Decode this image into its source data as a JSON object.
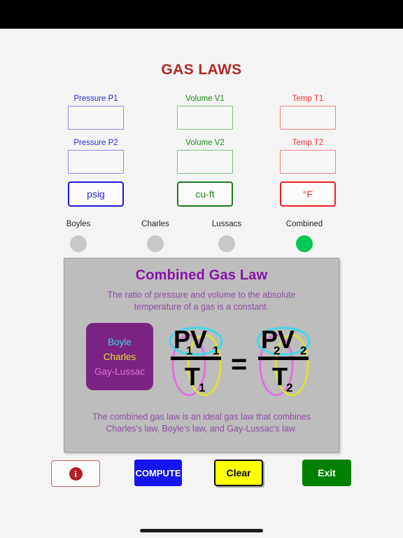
{
  "app": {
    "title": "GAS LAWS",
    "title_color": "#b02828",
    "background": "#f4f4f4"
  },
  "fields": {
    "pressure": {
      "accent": "#2929d9",
      "label1": "Pressure P1",
      "value1": "",
      "label2": "Pressure P2",
      "value2": "",
      "unit": "psig"
    },
    "volume": {
      "accent": "#1a8a1a",
      "label1": "Volume V1",
      "value1": "",
      "label2": "Volume V2",
      "value2": "",
      "unit": "cu-ft"
    },
    "temperature": {
      "accent": "#f03030",
      "label1": "Temp T1",
      "value1": "",
      "label2": "Temp T2",
      "value2": "",
      "unit": "°F"
    }
  },
  "law_selector": {
    "selected": "Combined",
    "on_color": "#00c853",
    "off_color": "#c8c8c8",
    "options": [
      {
        "label": "Boyles",
        "selected": false
      },
      {
        "label": "Charles",
        "selected": false
      },
      {
        "label": "Lussacs",
        "selected": false
      },
      {
        "label": "Combined",
        "selected": true
      }
    ]
  },
  "info_panel": {
    "background": "#bdbdbd",
    "heading": "Combined Gas Law",
    "heading_color": "#8710a8",
    "subtitle": "The ratio of pressure and volume to the absolute temperature of a gas is a constant.",
    "body_color": "#8a4d9e",
    "legend_box": {
      "background": "#7b2382",
      "items": [
        {
          "name": "Boyle",
          "color": "#3fd8e8"
        },
        {
          "name": "Charles",
          "color": "#e0e038"
        },
        {
          "name": "Gay-Lussac",
          "color": "#e070e0"
        }
      ]
    },
    "formula": {
      "left_numerator": "PV",
      "left_numerator_sub": "1",
      "left_denominator": "T",
      "left_denominator_sub": "1",
      "equals": "=",
      "right_numerator": "PV",
      "right_numerator_sub": "2",
      "right_denominator": "T",
      "right_denominator_sub": "2",
      "highlight_boyle": "#3fd8e8",
      "highlight_charles": "#e0e038",
      "highlight_gaylussac": "#e070e0"
    },
    "footer": "The combined gas law is an ideal gas law that combines Charles's law, Boyle's law, and Gay-Lussac's law."
  },
  "buttons": {
    "info": {
      "icon": "info-icon",
      "label": "i",
      "border": "#c06060"
    },
    "compute": {
      "label": "COMPUTE",
      "background": "#1414f0",
      "color": "#ffffff"
    },
    "clear": {
      "label": "Clear",
      "background": "#ffff00",
      "color": "#000000"
    },
    "exit": {
      "label": "Exit",
      "background": "#008000",
      "color": "#ffffff"
    }
  }
}
